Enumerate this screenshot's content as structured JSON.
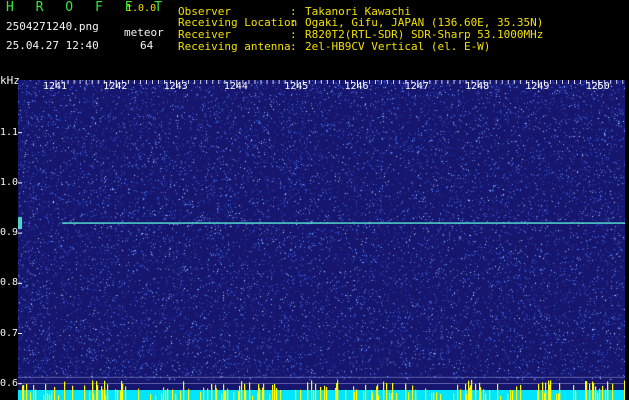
{
  "header": {
    "brand": "H R O F F T",
    "version": "1.0.0",
    "filename": "2504271240.png",
    "datetime": "25.04.27 12:40",
    "meteor_label": "meteor",
    "meteor_count": "64",
    "fields": [
      {
        "label": "Observer",
        "sep": ":",
        "value": "Takanori Kawachi"
      },
      {
        "label": "Receiving Location",
        "sep": ":",
        "value": "Ogaki, Gifu, JAPAN (136.60E, 35.35N)"
      },
      {
        "label": "Receiver",
        "sep": ":",
        "value": "R820T2(RTL-SDR) SDR-Sharp 53.1000MHz"
      },
      {
        "label": "Receiving antenna",
        "sep": ":",
        "value": "2el-HB9CV Vertical (el. E-W)"
      }
    ]
  },
  "axes": {
    "y_unit": "kHz",
    "y_ticks": [
      "1.1",
      "1.0",
      "0.9",
      "0.8",
      "0.7",
      "0.6"
    ],
    "x_ticks": [
      "1241",
      "1242",
      "1243",
      "1244",
      "1245",
      "1246",
      "1247",
      "1248",
      "1249",
      "1250"
    ]
  },
  "chart_data": {
    "type": "heatmap",
    "x": [
      1241,
      1242,
      1243,
      1244,
      1245,
      1246,
      1247,
      1248,
      1249,
      1250
    ],
    "y_ticks": [
      1.1,
      1.0,
      0.9,
      0.8,
      0.7,
      0.6
    ],
    "xlabel": "",
    "ylabel": "kHz",
    "carrier_line_khz": 0.92
  },
  "colors": {
    "background": "#16166e",
    "noise": "#4f7cff",
    "carrier": "#5fffe0",
    "green_text": "#39e639",
    "yellow_text": "#f0e000",
    "power_bar": "#ffff00",
    "power_fill": "#00e5ff"
  }
}
